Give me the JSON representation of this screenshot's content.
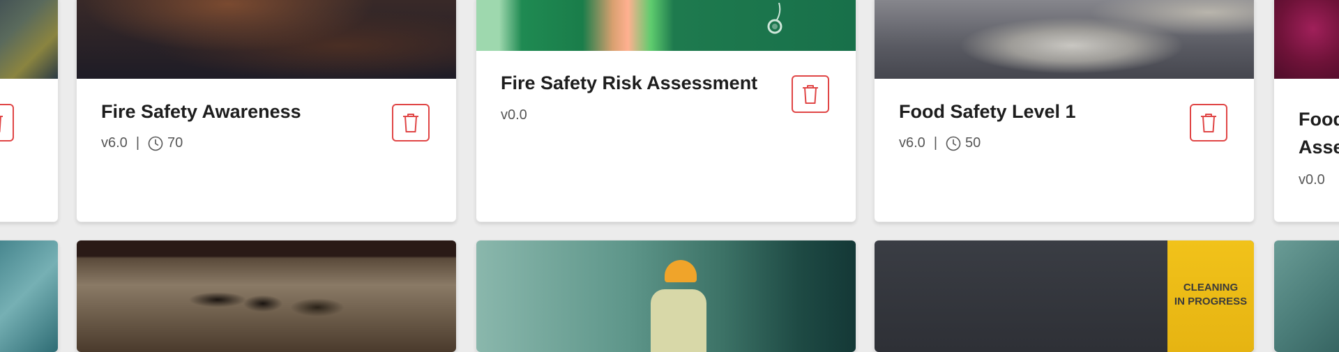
{
  "colors": {
    "accent_danger": "#e04545",
    "page_bg": "#ececec"
  },
  "icons": {
    "delete": "trash-icon",
    "duration": "clock-icon"
  },
  "cards_top": [
    {
      "title": "",
      "version": "",
      "duration": ""
    },
    {
      "title": "Fire Safety Awareness",
      "version": "v6.0",
      "duration": "70"
    },
    {
      "title": "Fire Safety Risk Assessment",
      "version": "v0.0"
    },
    {
      "title": "Food Safety Level 1",
      "version": "v6.0",
      "duration": "50"
    },
    {
      "title_line1": "Food",
      "title_line2": "Asse",
      "version": "v0.0"
    }
  ],
  "separator": "|",
  "cards_bottom_images": [
    {
      "caption_line1": "CLEANING",
      "caption_line2": "IN PROGRESS"
    }
  ]
}
